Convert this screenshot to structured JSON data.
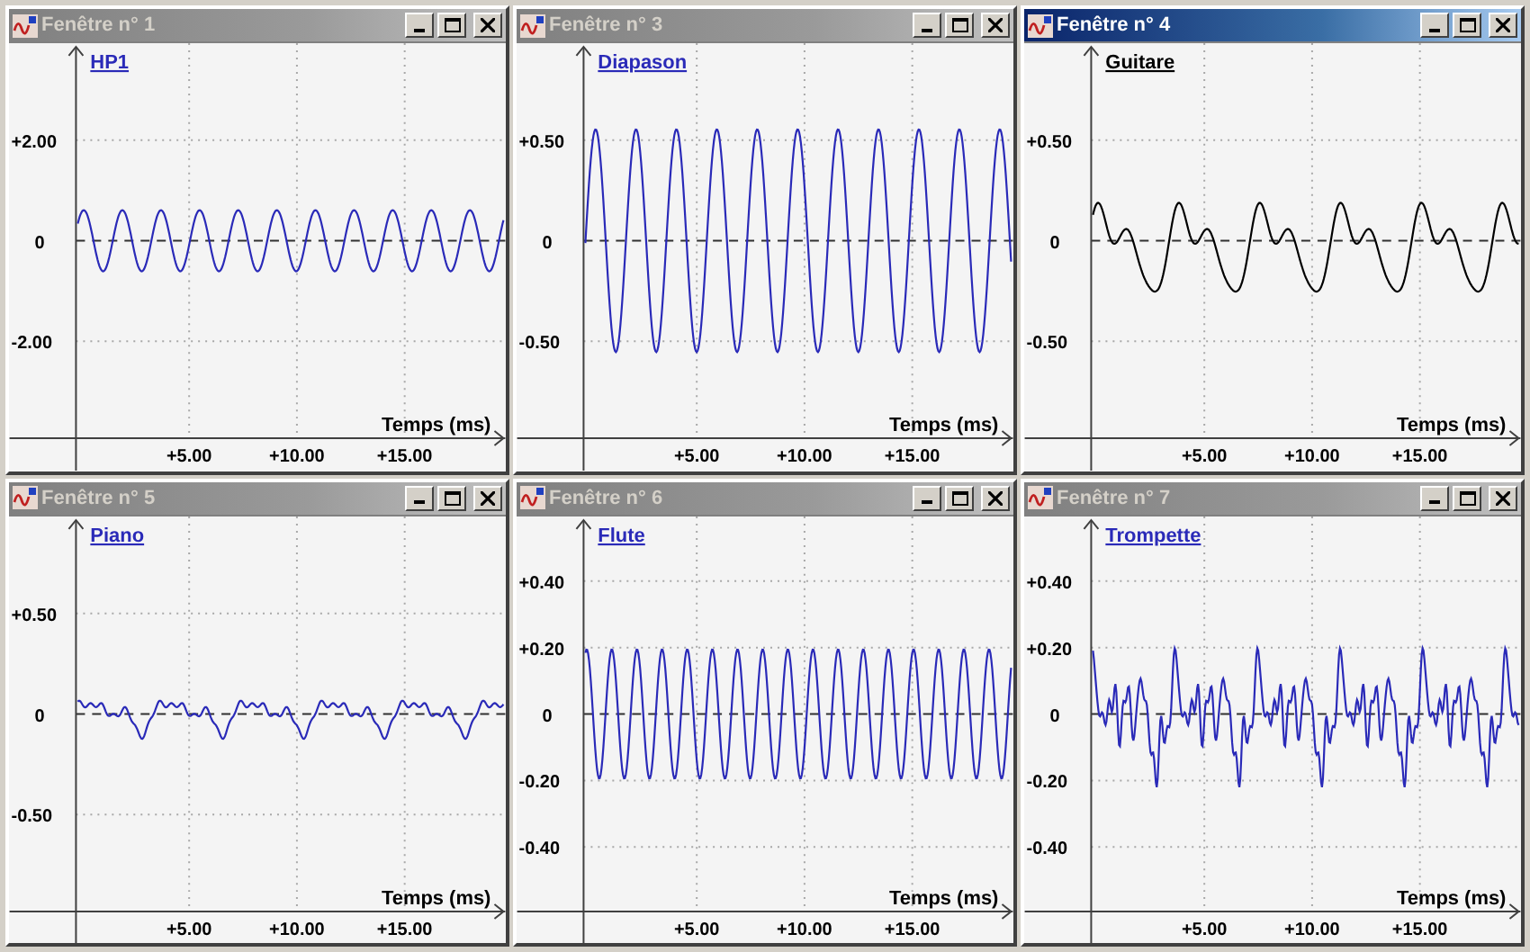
{
  "windows": [
    {
      "title": "Fenêtre n° 1",
      "active": false,
      "signal": "HP1",
      "color": "#2a2ab8",
      "kind": "hp",
      "y_ticks": [
        "+2.00",
        "0",
        "-2.00"
      ],
      "x_ticks": [
        "+5.00",
        "+10.00",
        "+15.00"
      ],
      "x_axis_title": "Temps (ms)"
    },
    {
      "title": "Fenêtre n° 3",
      "active": false,
      "signal": "Diapason",
      "color": "#2a2ab8",
      "kind": "tuning-fork",
      "y_ticks": [
        "+0.50",
        "0",
        "-0.50"
      ],
      "x_ticks": [
        "+5.00",
        "+10.00",
        "+15.00"
      ],
      "x_axis_title": "Temps (ms)"
    },
    {
      "title": "Fenêtre n° 4",
      "active": true,
      "signal": "Guitare",
      "color": "#000000",
      "kind": "guitar",
      "y_ticks": [
        "+0.50",
        "0",
        "-0.50"
      ],
      "x_ticks": [
        "+5.00",
        "+10.00",
        "+15.00"
      ],
      "x_axis_title": "Temps (ms)"
    },
    {
      "title": "Fenêtre n° 5",
      "active": false,
      "signal": "Piano",
      "color": "#2a2ab8",
      "kind": "piano",
      "y_ticks": [
        "+0.50",
        "0",
        "-0.50"
      ],
      "x_ticks": [
        "+5.00",
        "+10.00",
        "+15.00"
      ],
      "x_axis_title": "Temps (ms)"
    },
    {
      "title": "Fenêtre n° 6",
      "active": false,
      "signal": "Flute",
      "color": "#2a2ab8",
      "kind": "flute",
      "y_ticks": [
        "+0.40",
        "+0.20",
        "0",
        "-0.20",
        "-0.40"
      ],
      "x_ticks": [
        "+5.00",
        "+10.00",
        "+15.00"
      ],
      "x_axis_title": "Temps (ms)"
    },
    {
      "title": "Fenêtre n° 7",
      "active": false,
      "signal": "Trompette",
      "color": "#2a2ab8",
      "kind": "trumpet",
      "y_ticks": [
        "+0.40",
        "+0.20",
        "0",
        "-0.20",
        "-0.40"
      ],
      "x_ticks": [
        "+5.00",
        "+10.00",
        "+15.00"
      ],
      "x_axis_title": "Temps (ms)"
    }
  ]
}
